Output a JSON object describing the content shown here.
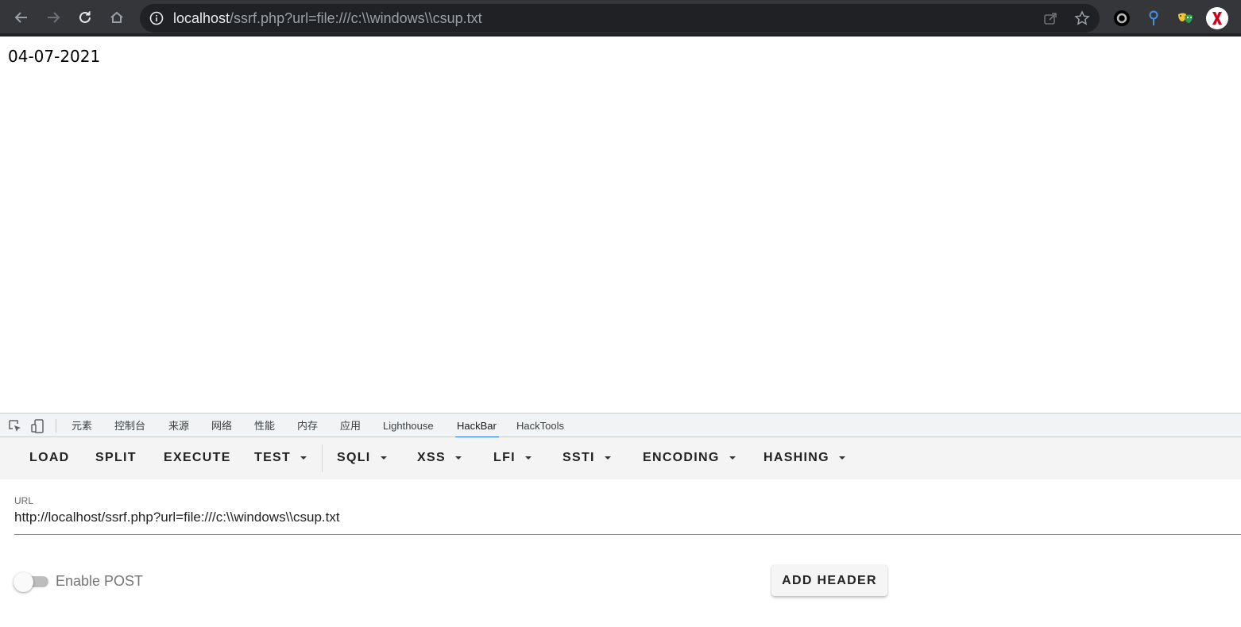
{
  "browser": {
    "url_host": "localhost",
    "url_rest": "/ssrf.php?url=file:///c:\\\\windows\\\\csup.txt",
    "icons": [
      "back-arrow-icon",
      "forward-arrow-icon",
      "reload-icon",
      "home-icon",
      "site-info-icon",
      "share-icon",
      "bookmark-star-icon"
    ],
    "extensions": [
      "circle-extension-icon",
      "pin-extension-icon",
      "mask-extension-icon",
      "x-extension-icon"
    ]
  },
  "page": {
    "content": "04-07-2021"
  },
  "devtools": {
    "tabs": [
      "元素",
      "控制台",
      "来源",
      "网络",
      "性能",
      "内存",
      "应用",
      "Lighthouse",
      "HackBar",
      "HackTools"
    ],
    "active_tab": "HackBar"
  },
  "hackbar": {
    "buttons": {
      "load": "LOAD",
      "split": "SPLIT",
      "execute": "EXECUTE",
      "test": "TEST",
      "sqli": "SQLI",
      "xss": "XSS",
      "lfi": "LFI",
      "ssti": "SSTI",
      "encoding": "ENCODING",
      "hashing": "HASHING"
    },
    "url_label": "URL",
    "url_value": "http://localhost/ssrf.php?url=file:///c:\\\\windows\\\\csup.txt",
    "enable_post_label": "Enable POST",
    "enable_post": false,
    "add_header_label": "ADD HEADER"
  },
  "colors": {
    "chrome_bg": "#35363a",
    "omnibox_bg": "#202124",
    "tab_active_underline": "#1a73e8",
    "toolbar_bg": "#f4f4f5"
  }
}
